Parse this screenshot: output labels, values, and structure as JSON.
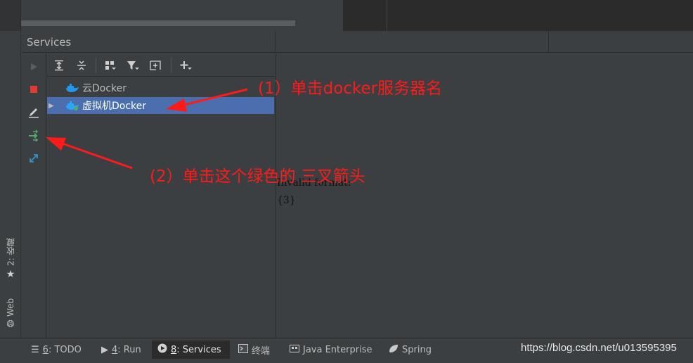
{
  "panel": {
    "title": "Services"
  },
  "left_stripe": {
    "tabs": [
      {
        "label": "2: 收藏",
        "icon": "star-icon"
      },
      {
        "label": "Web",
        "icon": "globe-icon"
      }
    ]
  },
  "actions": [
    {
      "name": "run",
      "icon": "play-icon",
      "enabled": false
    },
    {
      "name": "stop",
      "icon": "stop-icon",
      "color": "#e53935"
    },
    {
      "name": "edit",
      "icon": "pencil-icon"
    },
    {
      "name": "deploy",
      "icon": "green-arrows-icon",
      "color": "#59a869"
    },
    {
      "name": "expand",
      "icon": "expand-arrows-icon",
      "color": "#3592c4"
    }
  ],
  "tree_toolbar": [
    {
      "icon": "expand-all-icon"
    },
    {
      "icon": "collapse-all-icon"
    },
    {
      "icon": "group-by-icon"
    },
    {
      "icon": "filter-icon"
    },
    {
      "icon": "add-service-icon"
    },
    {
      "icon": "plus-icon"
    }
  ],
  "tree": {
    "items": [
      {
        "label": "云Docker",
        "selected": false,
        "expandable": false
      },
      {
        "label": "虚拟机Docker",
        "selected": true,
        "expandable": true
      }
    ]
  },
  "details": {
    "line1": "Invalid format:",
    "line2": "{3}"
  },
  "annotations": {
    "step1": "(1）单击docker服务器名",
    "step2": "(2）单击这个绿色的 三叉箭头",
    "color": "#ff1a1a"
  },
  "bottom_bar": {
    "tabs": [
      {
        "key": "6",
        "label": ": TODO",
        "icon": "list-icon",
        "active": false
      },
      {
        "key": "4",
        "label": ": Run",
        "icon": "run-icon",
        "active": false
      },
      {
        "key": "8",
        "label": ": Services",
        "icon": "services-icon",
        "active": true
      },
      {
        "key": "",
        "label": "终端",
        "icon": "terminal-icon",
        "active": false
      },
      {
        "key": "",
        "label": "Java Enterprise",
        "icon": "java-enterprise-icon",
        "active": false
      },
      {
        "key": "",
        "label": "Spring",
        "icon": "spring-icon",
        "active": false
      }
    ],
    "watermark": "https://blog.csdn.net/u013595395"
  }
}
